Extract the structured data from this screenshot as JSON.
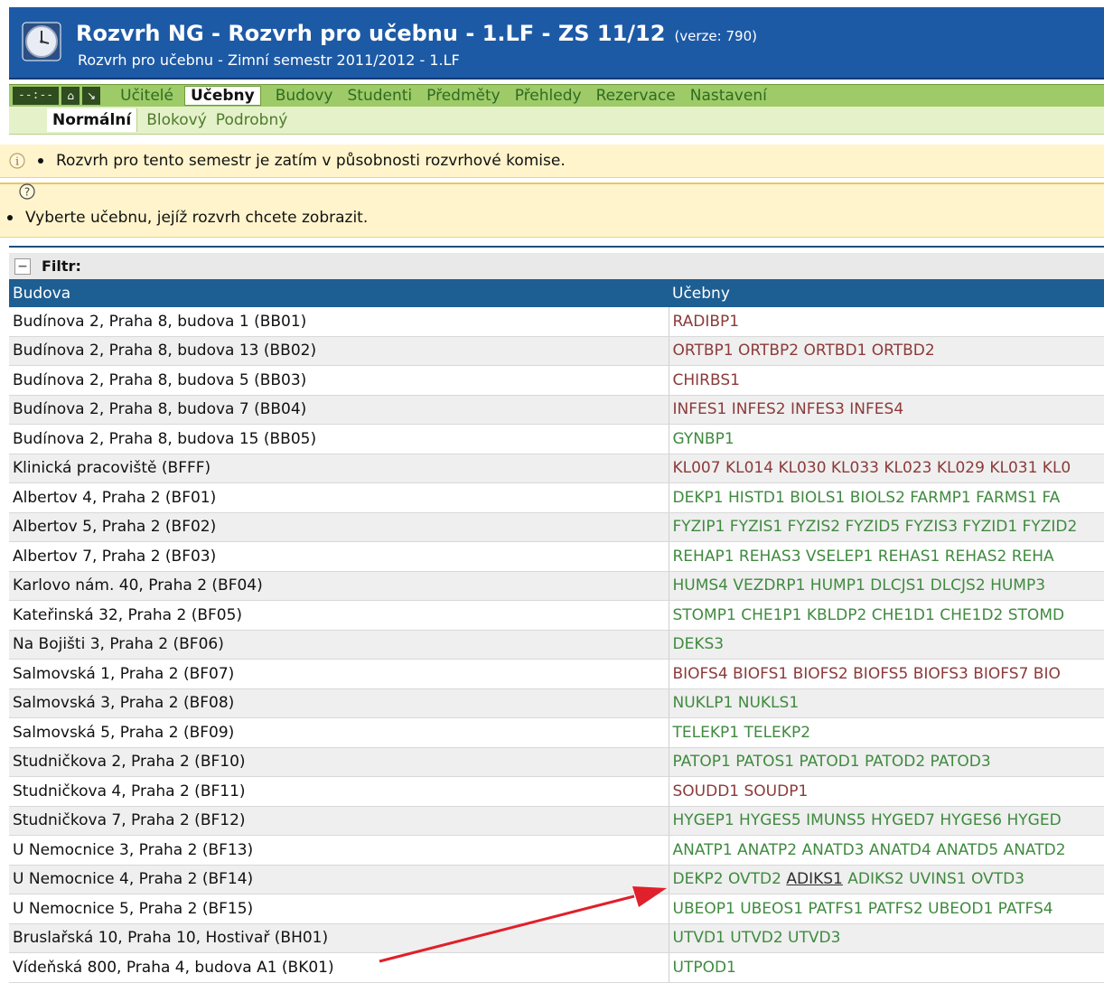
{
  "header": {
    "title": "Rozvrh NG - Rozvrh pro učebnu - 1.LF - ZS 11/12",
    "version": "(verze: 790)",
    "subtitle": "Rozvrh pro učebnu - Zimní semestr 2011/2012 - 1.LF"
  },
  "menu": {
    "clock": "--:--",
    "items": [
      "Učitelé",
      "Učebny",
      "Budovy",
      "Studenti",
      "Předměty",
      "Přehledy",
      "Rezervace",
      "Nastavení"
    ],
    "active": "Učebny"
  },
  "submenu": {
    "items": [
      "Normální",
      "Blokový",
      "Podrobný"
    ],
    "active": "Normální"
  },
  "info": {
    "message": "Rozvrh pro tento semestr je zatím v působnosti rozvrhové komise."
  },
  "help": {
    "message": "Vyberte učebnu, jejíž rozvrh chcete zobrazit."
  },
  "filter": {
    "label": "Filtr:"
  },
  "table": {
    "headers": [
      "Budova",
      "Učebny"
    ],
    "rows": [
      {
        "building": "Budínova 2, Praha 8, budova 1 (BB01)",
        "rooms": "RADIBP1",
        "color": "red"
      },
      {
        "building": "Budínova 2, Praha 8, budova 13 (BB02)",
        "rooms": "ORTBP1 ORTBP2 ORTBD1 ORTBD2",
        "color": "red"
      },
      {
        "building": "Budínova 2, Praha 8, budova 5 (BB03)",
        "rooms": "CHIRBS1",
        "color": "red"
      },
      {
        "building": "Budínova 2, Praha 8, budova 7 (BB04)",
        "rooms": "INFES1 INFES2 INFES3 INFES4",
        "color": "red"
      },
      {
        "building": "Budínova 2, Praha 8, budova 15 (BB05)",
        "rooms": "GYNBP1",
        "color": "green"
      },
      {
        "building": "Klinická pracoviště (BFFF)",
        "rooms": "KL007 KL014 KL030 KL033 KL023 KL029 KL031 KL0",
        "color": "red"
      },
      {
        "building": "Albertov 4, Praha 2 (BF01)",
        "rooms": "DEKP1 HISTD1 BIOLS1 BIOLS2 FARMP1 FARMS1 FA",
        "color": "green"
      },
      {
        "building": "Albertov 5, Praha 2 (BF02)",
        "rooms": "FYZIP1 FYZIS1 FYZIS2 FYZID5 FYZIS3 FYZID1 FYZID2",
        "color": "green"
      },
      {
        "building": "Albertov 7, Praha 2 (BF03)",
        "rooms": "REHAP1 REHAS3 VSELEP1 REHAS1 REHAS2 REHA",
        "color": "green"
      },
      {
        "building": "Karlovo nám. 40, Praha 2 (BF04)",
        "rooms": "HUMS4 VEZDRP1 HUMP1 DLCJS1 DLCJS2 HUMP3",
        "color": "green"
      },
      {
        "building": "Kateřinská 32, Praha 2 (BF05)",
        "rooms": "STOMP1 CHE1P1 KBLDP2 CHE1D1 CHE1D2 STOMD",
        "color": "green"
      },
      {
        "building": "Na Bojišti 3, Praha 2 (BF06)",
        "rooms": "DEKS3",
        "color": "green"
      },
      {
        "building": "Salmovská 1, Praha 2 (BF07)",
        "rooms": "BIOFS4 BIOFS1 BIOFS2 BIOFS5 BIOFS3 BIOFS7 BIO",
        "color": "red"
      },
      {
        "building": "Salmovská 3, Praha 2 (BF08)",
        "rooms": "NUKLP1 NUKLS1",
        "color": "green"
      },
      {
        "building": "Salmovská 5, Praha 2 (BF09)",
        "rooms": "TELEKP1 TELEKP2",
        "color": "green"
      },
      {
        "building": "Studničkova 2, Praha 2 (BF10)",
        "rooms": "PATOP1 PATOS1 PATOD1 PATOD2 PATOD3",
        "color": "green"
      },
      {
        "building": "Studničkova 4, Praha 2 (BF11)",
        "rooms": "SOUDD1 SOUDP1",
        "color": "red"
      },
      {
        "building": "Studničkova 7, Praha 2 (BF12)",
        "rooms": "HYGEP1 HYGES5 IMUNS5 HYGED7 HYGES6 HYGED",
        "color": "green"
      },
      {
        "building": "U Nemocnice 3, Praha 2 (BF13)",
        "rooms": "ANATP1 ANATP2 ANATD3 ANATD4 ANATD5 ANATD2",
        "color": "green"
      },
      {
        "building": "U Nemocnice 4, Praha 2 (BF14)",
        "rooms_pre": "DEKP2 OVTD2 ",
        "rooms_link": "ADIKS1",
        "rooms_post": " ADIKS2 UVINS1 OVTD3",
        "color": "green"
      },
      {
        "building": "U Nemocnice 5, Praha 2 (BF15)",
        "rooms": "UBEOP1 UBEOS1 PATFS1 PATFS2 UBEOD1 PATFS4",
        "color": "green"
      },
      {
        "building": "Bruslařská 10, Praha 10, Hostivař (BH01)",
        "rooms": "UTVD1 UTVD2 UTVD3",
        "color": "green"
      },
      {
        "building": "Vídeňská 800, Praha 4, budova A1 (BK01)",
        "rooms": "UTPOD1",
        "color": "green"
      }
    ]
  },
  "colors": {
    "header_bg": "#1d5aa6",
    "menu_bg": "#9ecb68",
    "submenu_bg": "#e4f1c9",
    "info_bg": "#fff4cc",
    "table_header_bg": "#1d5e93",
    "arrow": "#e0202a"
  }
}
